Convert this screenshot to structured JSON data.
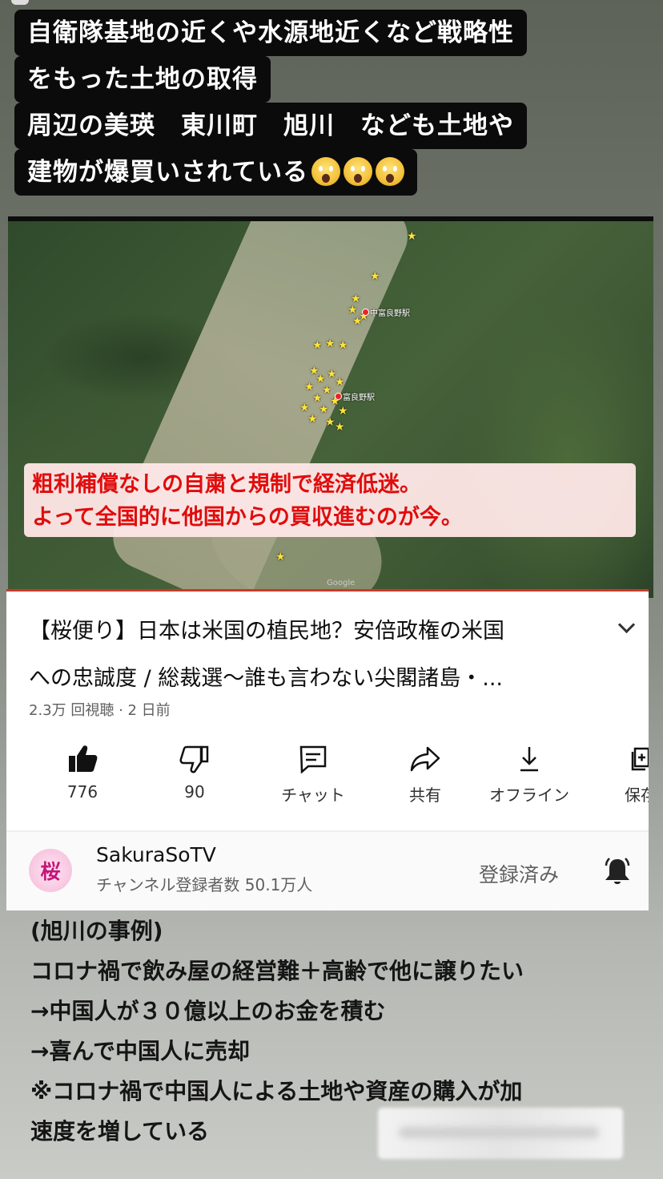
{
  "caption": {
    "lines": [
      "自衛隊基地の近くや水源地近くなど戦略性",
      "をもった土地の取得",
      "周辺の美瑛　東川町　旭川　なども土地や",
      "建物が爆買いされている"
    ],
    "emoji": "scream-face-emoji"
  },
  "map": {
    "station_labels": [
      "中富良野駅",
      "富良野駅"
    ],
    "watermark": "Google",
    "overlay_lines": [
      "粗利補償なしの自粛と規制で経済低迷。",
      "よって全国的に他国からの買収進むのが今。"
    ]
  },
  "video": {
    "title_line1": "【桜便り】日本は米国の植民地？安倍政権の米国",
    "title_line2": "への忠誠度 / 総裁選〜誰も言わない尖閣諸島・...",
    "meta": "2.3万 回視聴 · 2 日前",
    "actions": {
      "like": "776",
      "dislike": "90",
      "chat": "チャット",
      "share": "共有",
      "offline": "オフライン",
      "save": "保存"
    },
    "channel": {
      "avatar_text": "桜",
      "name": "SakuraSoTV",
      "subscribers": "チャンネル登録者数 50.1万人",
      "subscribed_label": "登録済み"
    }
  },
  "body_text": {
    "lines": [
      "(旭川の事例)",
      "コロナ禍で飲み屋の経営難＋高齢で他に譲りたい",
      "→中国人が３０億以上のお金を積む",
      "→喜んで中国人に売却",
      "※コロナ禍で中国人による土地や資産の購入が加",
      "速度を増している"
    ]
  },
  "colors": {
    "overlay_text": "#e00d0d",
    "caption_bg": "#0b0b0b",
    "video_progress": "#c83a2a"
  }
}
